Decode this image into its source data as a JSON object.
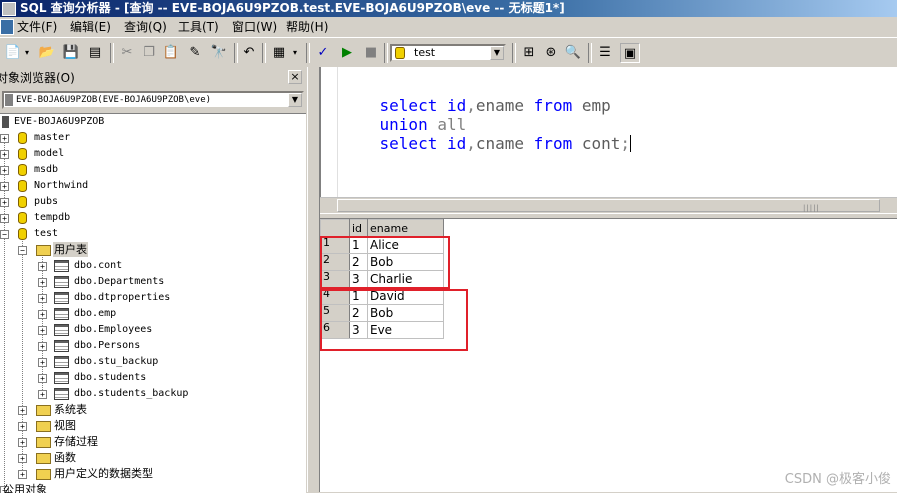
{
  "window": {
    "title": "SQL 查询分析器 - [查询 -- EVE-BOJA6U9PZOB.test.EVE-BOJA6U9PZOB\\eve -- 无标题1*]"
  },
  "menu": [
    {
      "label": "文件(F)"
    },
    {
      "label": "编辑(E)"
    },
    {
      "label": "查询(Q)"
    },
    {
      "label": "工具(T)"
    },
    {
      "label": "窗口(W)"
    },
    {
      "label": "帮助(H)"
    }
  ],
  "toolbar": {
    "database": "test",
    "icons": [
      "new-query-icon",
      "open-icon",
      "save-icon",
      "load-script-icon",
      "cut-icon",
      "copy-icon",
      "paste-icon",
      "clear-icon",
      "find-icon",
      "undo-icon",
      "results-mode-icon",
      "parse-icon",
      "execute-icon",
      "cancel-icon",
      "execution-plan-icon",
      "index-tuning-icon",
      "object-search-icon",
      "properties-icon",
      "object-browser-icon"
    ]
  },
  "object_browser": {
    "title": "对象浏览器(O)",
    "close": "×",
    "server": "EVE-BOJA6U9PZOB(EVE-BOJA6U9PZOB\\eve)",
    "root": "EVE-BOJA6U9PZOB",
    "databases": [
      "master",
      "model",
      "msdb",
      "Northwind",
      "pubs",
      "tempdb",
      "test"
    ],
    "user_tables_label": "用户表",
    "tables": [
      "dbo.cont",
      "dbo.Departments",
      "dbo.dtproperties",
      "dbo.emp",
      "dbo.Employees",
      "dbo.Persons",
      "dbo.stu_backup",
      "dbo.students",
      "dbo.students_backup"
    ],
    "folders": [
      "系统表",
      "视图",
      "存储过程",
      "函数",
      "用户定义的数据类型"
    ],
    "public_objects": "公用对象"
  },
  "editor": {
    "lines": [
      [
        {
          "t": "select ",
          "k": "kw"
        },
        {
          "t": "id",
          "k": "kw"
        },
        {
          "t": ",",
          "k": "op"
        },
        {
          "t": "ename ",
          "k": "plain"
        },
        {
          "t": "from ",
          "k": "kw"
        },
        {
          "t": "emp",
          "k": "plain"
        }
      ],
      [
        {
          "t": "union ",
          "k": "kw"
        },
        {
          "t": "all",
          "k": "op"
        }
      ],
      [
        {
          "t": "select ",
          "k": "kw"
        },
        {
          "t": "id",
          "k": "kw"
        },
        {
          "t": ",",
          "k": "op"
        },
        {
          "t": "cname ",
          "k": "plain"
        },
        {
          "t": "from ",
          "k": "kw"
        },
        {
          "t": "cont",
          "k": "plain"
        },
        {
          "t": ";",
          "k": "op"
        }
      ]
    ]
  },
  "results": {
    "columns": [
      "id",
      "ename"
    ],
    "rows": [
      {
        "n": "1",
        "id": "1",
        "name": "Alice"
      },
      {
        "n": "2",
        "id": "2",
        "name": "Bob"
      },
      {
        "n": "3",
        "id": "3",
        "name": "Charlie"
      },
      {
        "n": "4",
        "id": "1",
        "name": "David"
      },
      {
        "n": "5",
        "id": "2",
        "name": "Bob"
      },
      {
        "n": "6",
        "id": "3",
        "name": "Eve"
      }
    ],
    "highlight_color": "#e0202a"
  },
  "watermark": "CSDN @极客小俊"
}
